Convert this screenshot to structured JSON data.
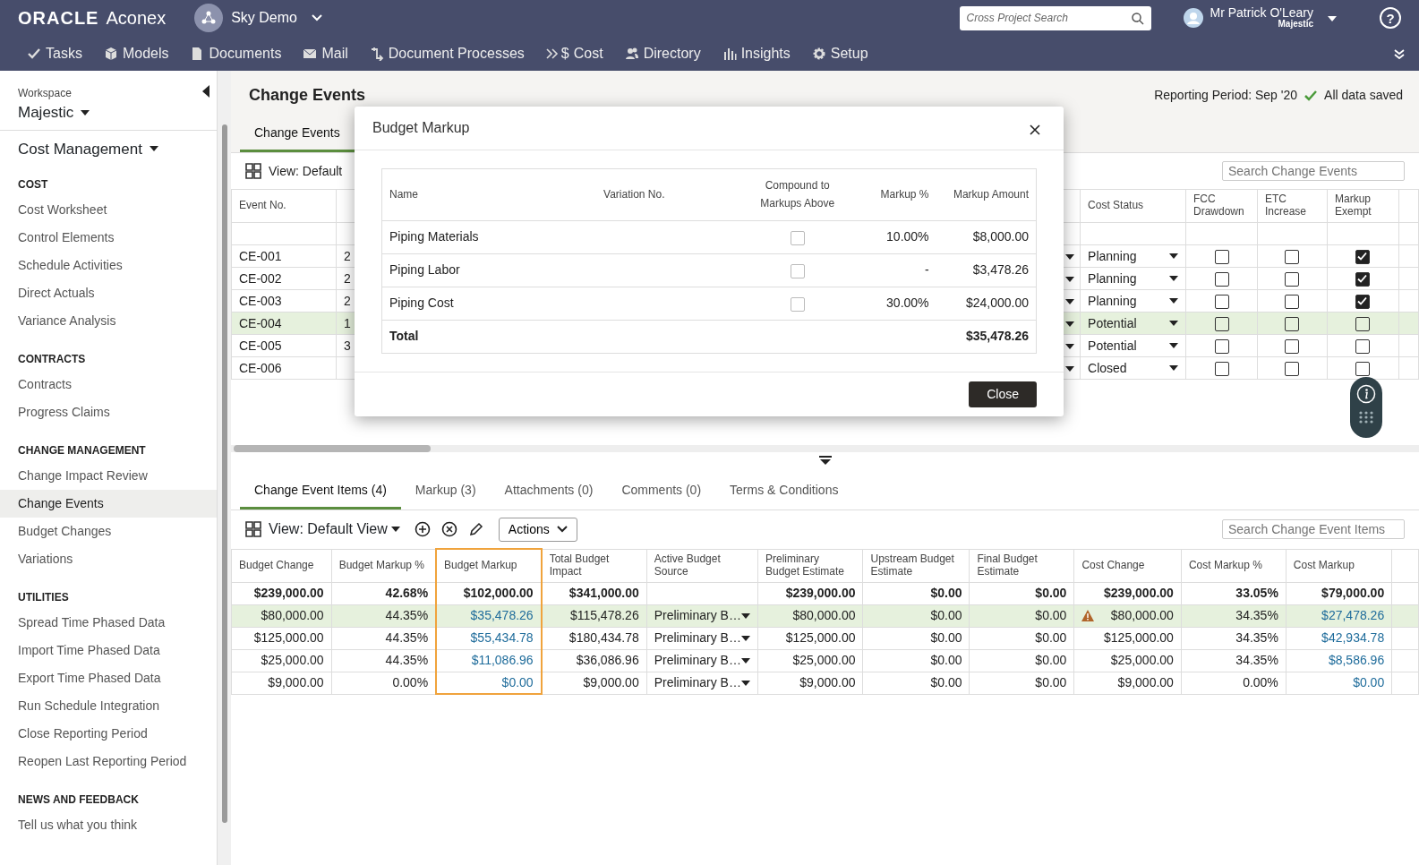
{
  "header": {
    "brand": "ORACLE",
    "product": "Aconex",
    "project": "Sky Demo",
    "search_placeholder": "Cross Project Search",
    "user_name": "Mr Patrick O'Leary",
    "user_org": "Majestic",
    "help": "?"
  },
  "nav": [
    {
      "label": "Tasks",
      "kind": "check"
    },
    {
      "label": "Models",
      "kind": "cube"
    },
    {
      "label": "Documents",
      "kind": "document"
    },
    {
      "label": "Mail",
      "kind": "mail"
    },
    {
      "label": "Document Processes",
      "kind": "process"
    },
    {
      "label": "Cost",
      "kind": "cost",
      "glyph": "$"
    },
    {
      "label": "Directory",
      "kind": "people"
    },
    {
      "label": "Insights",
      "kind": "bars"
    },
    {
      "label": "Setup",
      "kind": "gear"
    }
  ],
  "sidebar": {
    "workspace_label": "Workspace",
    "workspace": "Majestic",
    "module": "Cost Management",
    "sections": [
      {
        "heading": "COST",
        "items": [
          {
            "label": "Cost Worksheet",
            "selected": false
          },
          {
            "label": "Control Elements",
            "selected": false
          },
          {
            "label": "Schedule Activities",
            "selected": false
          },
          {
            "label": "Direct Actuals",
            "selected": false
          },
          {
            "label": "Variance Analysis",
            "selected": false
          }
        ]
      },
      {
        "heading": "CONTRACTS",
        "items": [
          {
            "label": "Contracts",
            "selected": false
          },
          {
            "label": "Progress Claims",
            "selected": false
          }
        ]
      },
      {
        "heading": "CHANGE MANAGEMENT",
        "items": [
          {
            "label": "Change Impact Review",
            "selected": false
          },
          {
            "label": "Change Events",
            "selected": true
          },
          {
            "label": "Budget Changes",
            "selected": false
          },
          {
            "label": "Variations",
            "selected": false
          }
        ]
      },
      {
        "heading": "UTILITIES",
        "items": [
          {
            "label": "Spread Time Phased Data",
            "selected": false
          },
          {
            "label": "Import Time Phased Data",
            "selected": false
          },
          {
            "label": "Export Time Phased Data",
            "selected": false
          },
          {
            "label": "Run Schedule Integration",
            "selected": false
          },
          {
            "label": "Close Reporting Period",
            "selected": false
          },
          {
            "label": "Reopen Last Reporting Period",
            "selected": false
          }
        ]
      },
      {
        "heading": "NEWS AND FEEDBACK",
        "items": [
          {
            "label": "Tell us what you think",
            "selected": false
          }
        ]
      }
    ]
  },
  "page": {
    "title": "Change Events",
    "reporting_period": "Reporting Period: Sep '20",
    "save_status": "All data saved",
    "tabs": [
      {
        "label": "Change Events",
        "selected": true
      }
    ],
    "view": "View: Default",
    "search_placeholder": "Search Change Events"
  },
  "events_table": {
    "columns": [
      "Event No.",
      "Cost Status",
      "FCC Drawdown",
      "ETC Increase",
      "Markup Exempt"
    ],
    "rows": [
      {
        "event_no": "CE-001",
        "column_2": "2",
        "cost_status": "Planning",
        "fcc_drawdown": false,
        "etc_increase": false,
        "markup_exempt": true,
        "selected": false
      },
      {
        "event_no": "CE-002",
        "column_2": "2",
        "cost_status": "Planning",
        "fcc_drawdown": false,
        "etc_increase": false,
        "markup_exempt": true,
        "selected": false
      },
      {
        "event_no": "CE-003",
        "column_2": "2",
        "cost_status": "Planning",
        "fcc_drawdown": false,
        "etc_increase": false,
        "markup_exempt": true,
        "selected": false
      },
      {
        "event_no": "CE-004",
        "column_2": "1",
        "cost_status": "Potential",
        "fcc_drawdown": false,
        "etc_increase": false,
        "markup_exempt": false,
        "selected": true
      },
      {
        "event_no": "CE-005",
        "column_2": "3",
        "cost_status": "Potential",
        "fcc_drawdown": false,
        "etc_increase": false,
        "markup_exempt": false,
        "selected": false
      },
      {
        "event_no": "CE-006",
        "cost_status": "Closed",
        "fcc_drawdown": false,
        "etc_increase": false,
        "markup_exempt": false,
        "selected": false
      }
    ]
  },
  "modal": {
    "title": "Budget Markup",
    "columns": [
      "Name",
      "Variation No.",
      "Compound to Markups Above",
      "Markup %",
      "Markup Amount"
    ],
    "rows": [
      {
        "name": "Piping Materials",
        "compound": false,
        "markup_pct": "10.00%",
        "amount": "$8,000.00"
      },
      {
        "name": "Piping Labor",
        "compound": false,
        "markup_pct": "-",
        "amount": "$3,478.26"
      },
      {
        "name": "Piping Cost",
        "compound": false,
        "markup_pct": "30.00%",
        "amount": "$24,000.00"
      }
    ],
    "total": {
      "label": "Total",
      "amount": "$35,478.26"
    },
    "close_button": "Close"
  },
  "items_panel": {
    "tabs": [
      {
        "label": "Change Event Items (4)",
        "selected": true
      },
      {
        "label": "Markup (3)",
        "selected": false
      },
      {
        "label": "Attachments (0)",
        "selected": false
      },
      {
        "label": "Comments (0)",
        "selected": false
      },
      {
        "label": "Terms & Conditions",
        "selected": false
      }
    ],
    "view": "View: Default View",
    "actions": "Actions",
    "search_placeholder": "Search Change Event Items",
    "columns": [
      {
        "label": "Budget Change",
        "kind": "number",
        "highlighted": false
      },
      {
        "label": "Budget Markup %",
        "kind": "number",
        "highlighted": false
      },
      {
        "label": "Budget Markup",
        "kind": "link",
        "highlighted": true
      },
      {
        "label": "Total Budget Impact",
        "kind": "number",
        "highlighted": false
      },
      {
        "label": "Active Budget Source",
        "kind": "dropdown",
        "highlighted": false
      },
      {
        "label": "Preliminary Budget Estimate",
        "kind": "number",
        "highlighted": false
      },
      {
        "label": "Upstream Budget Estimate",
        "kind": "number",
        "highlighted": false
      },
      {
        "label": "Final Budget Estimate",
        "kind": "number",
        "highlighted": false
      },
      {
        "label": "Cost Change",
        "kind": "number",
        "highlighted": false
      },
      {
        "label": "Cost Markup %",
        "kind": "number",
        "highlighted": false
      },
      {
        "label": "Cost Markup",
        "kind": "link",
        "highlighted": false
      }
    ],
    "totals": [
      "$239,000.00",
      "42.68%",
      "$102,000.00",
      "$341,000.00",
      "$239,000.00",
      "$0.00",
      "$0.00",
      "$239,000.00",
      "33.05%",
      "$79,000.00"
    ],
    "rows": [
      {
        "selected": true,
        "warning": true,
        "cells": [
          "$80,000.00",
          "44.35%",
          "$35,478.26",
          "$115,478.26",
          "Preliminary B…",
          "$80,000.00",
          "$0.00",
          "$0.00",
          "$80,000.00",
          "34.35%",
          "$27,478.26"
        ]
      },
      {
        "selected": false,
        "warning": false,
        "cells": [
          "$125,000.00",
          "44.35%",
          "$55,434.78",
          "$180,434.78",
          "Preliminary B…",
          "$125,000.00",
          "$0.00",
          "$0.00",
          "$125,000.00",
          "34.35%",
          "$42,934.78"
        ]
      },
      {
        "selected": false,
        "warning": false,
        "cells": [
          "$25,000.00",
          "44.35%",
          "$11,086.96",
          "$36,086.96",
          "Preliminary B…",
          "$25,000.00",
          "$0.00",
          "$0.00",
          "$25,000.00",
          "34.35%",
          "$8,586.96"
        ]
      },
      {
        "selected": false,
        "warning": false,
        "cells": [
          "$9,000.00",
          "0.00%",
          "$0.00",
          "$9,000.00",
          "Preliminary B…",
          "$9,000.00",
          "$0.00",
          "$0.00",
          "$9,000.00",
          "0.00%",
          "$0.00"
        ]
      }
    ]
  }
}
